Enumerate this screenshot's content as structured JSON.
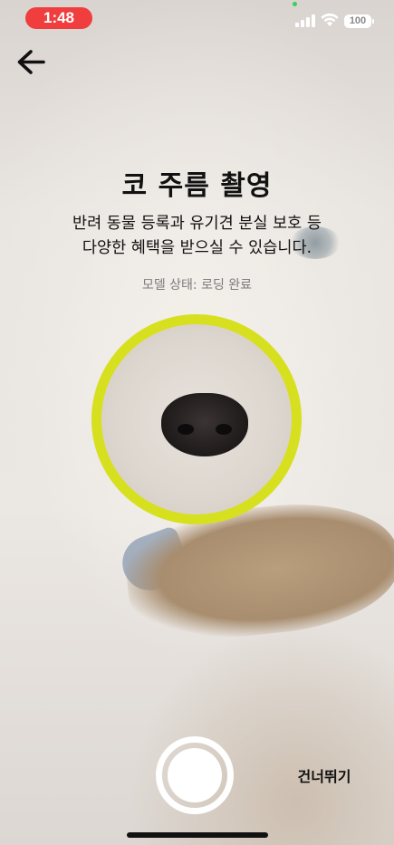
{
  "status_bar": {
    "time": "1:48",
    "battery": "100"
  },
  "header": {
    "back_icon": "arrow-left-icon"
  },
  "title": "코 주름 촬영",
  "description": {
    "line1": "반려 동물 등록과 유기견 분실 보호 등",
    "line2": "다양한 혜택을 받으실 수 있습니다."
  },
  "model_status": "모델 상태: 로딩 완료",
  "scan_ring_color": "#d7e01f",
  "bottom": {
    "shutter_icon": "shutter-icon",
    "skip_label": "건너뛰기"
  }
}
